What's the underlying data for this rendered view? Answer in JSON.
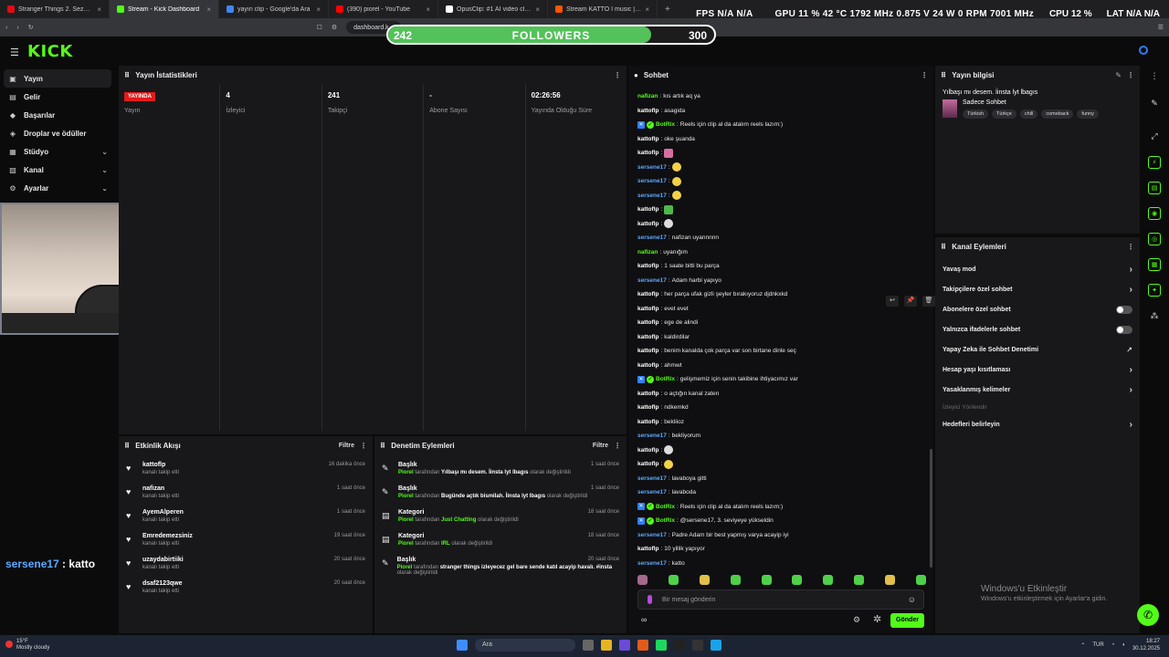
{
  "browser": {
    "tabs": [
      {
        "title": "Stranger Things 2. Sezon 5. Bölüm izle",
        "color": "#e50914",
        "active": false
      },
      {
        "title": "Stream - Kick Dashboard",
        "color": "#53fc18",
        "active": true
      },
      {
        "title": "yayın clip - Google'da Ara",
        "color": "#4285f4",
        "active": false
      },
      {
        "title": "(390) piorel - YouTube",
        "color": "#ff0000",
        "active": false
      },
      {
        "title": "OpusClip: #1 AI video clipping and e",
        "color": "#ffffff",
        "active": false
      },
      {
        "title": "Stream KATTO I music | Listen to sev",
        "color": "#ff5500",
        "active": false
      }
    ],
    "new_tab": "+",
    "address": "dashboard.k"
  },
  "osd": {
    "fps_label": "FPS",
    "fps_val1": "N/A",
    "fps_val2": "N/A",
    "gpu_label": "GPU",
    "gpu_load": "11 %",
    "gpu_temp": "42 °C",
    "gpu_clock": "1792 MHz",
    "gpu_volt": "0.875 V",
    "gpu_power": "24 W",
    "gpu_fan": "0 RPM",
    "gpu_mem": "7001 MHz",
    "cpu_label": "CPU",
    "cpu_load": "12 %",
    "lat_label": "LAT",
    "lat_val1": "N/A",
    "lat_val2": "N/A"
  },
  "followers": {
    "current": "242",
    "label": "FOLLOWERS",
    "goal": "300",
    "progress": 0.807
  },
  "header": {
    "logo": "KICK",
    "menu_icon": "hamburger-icon"
  },
  "nav": [
    {
      "label": "Yayın",
      "icon": "▣",
      "chev": "",
      "active": true
    },
    {
      "label": "Gelir",
      "icon": "▤",
      "chev": "",
      "active": false
    },
    {
      "label": "Başarılar",
      "icon": "◆",
      "chev": "",
      "active": false
    },
    {
      "label": "Droplar ve ödüller",
      "icon": "◈",
      "chev": "",
      "active": false
    },
    {
      "label": "Stüdyo",
      "icon": "▦",
      "chev": "⌄",
      "active": false
    },
    {
      "label": "Kanal",
      "icon": "▧",
      "chev": "⌄",
      "active": false
    },
    {
      "label": "Ayarlar",
      "icon": "⚙",
      "chev": "⌄",
      "active": false
    }
  ],
  "overlay_chat": {
    "user": "sersene17",
    "sep": " : ",
    "text": "katto"
  },
  "stats": {
    "title": "Yayın İstatistikleri",
    "cols": [
      {
        "value": "YAYINDA",
        "label": "Yayın",
        "live": true
      },
      {
        "value": "4",
        "label": "İzleyici",
        "live": false
      },
      {
        "value": "241",
        "label": "Takipçi",
        "live": false
      },
      {
        "value": "-",
        "label": "Abone Sayısı",
        "live": false
      },
      {
        "value": "02:26:56",
        "label": "Yayında Olduğu Süre",
        "live": false
      }
    ]
  },
  "activity": {
    "title": "Etkinlik Akışı",
    "filter": "Filtre",
    "items": [
      {
        "name": "kattoflp",
        "desc": "kanalı takip etti",
        "time": "16 dakika önce"
      },
      {
        "name": "nafizan",
        "desc": "kanalı takip etti",
        "time": "1 saat önce"
      },
      {
        "name": "AyemAlperen",
        "desc": "kanalı takip etti",
        "time": "1 saat önce"
      },
      {
        "name": "Emredemezsiniz",
        "desc": "kanalı takip etti",
        "time": "19 saat önce"
      },
      {
        "name": "uzaydabirtiiki",
        "desc": "kanalı takip etti",
        "time": "20 saat önce"
      },
      {
        "name": "dsaf2123qwe",
        "desc": "kanalı takip etti",
        "time": "20 saat önce"
      }
    ]
  },
  "moderation": {
    "title": "Denetim Eylemleri",
    "filter": "Filtre",
    "items": [
      {
        "type": "Başlık",
        "icon": "✎",
        "actor": "Piorel",
        "mid": " tarafından ",
        "value": "Yılbaşı mı desem. İinsta lyt lbagıs",
        "end": " olarak değiştirildi",
        "time": "1 saat önce",
        "green": false
      },
      {
        "type": "Başlık",
        "icon": "✎",
        "actor": "Piorel",
        "mid": " tarafından ",
        "value": "Bugünde açtık bismilah. İinsta lyt lbagıs",
        "end": " olarak değiştirildi",
        "time": "1 saat önce",
        "green": false
      },
      {
        "type": "Kategori",
        "icon": "▤",
        "actor": "Piorel",
        "mid": " tarafından ",
        "value": "Just Chatting",
        "end": " olarak değiştirildi",
        "time": "18 saat önce",
        "green": true
      },
      {
        "type": "Kategori",
        "icon": "▤",
        "actor": "Piorel",
        "mid": " tarafından ",
        "value": "IRL",
        "end": " olarak değiştirildi",
        "time": "18 saat önce",
        "green": true
      },
      {
        "type": "Başlık",
        "icon": "✎",
        "actor": "Piorel",
        "mid": " tarafından ",
        "value": "stranger things izleyecez gel bare sende katıl acayip havalı. #insta",
        "end": " olarak değiştirildi",
        "time": "20 saat önce",
        "green": false
      }
    ]
  },
  "chat": {
    "title": "Sohbet",
    "messages": [
      {
        "user": "nafizan",
        "color": "#53fc18",
        "text": "kıs artık aq ya",
        "badge": false,
        "emote": ""
      },
      {
        "user": "kattoflp",
        "color": "#ffffff",
        "text": "asagida",
        "badge": false,
        "emote": ""
      },
      {
        "user": "BotRix",
        "color": "#53fc18",
        "text": "Reels için clip al da atalım reels lazım:)",
        "badge": true,
        "emote": ""
      },
      {
        "user": "kattoflp",
        "color": "#ffffff",
        "text": "oke şuanda",
        "badge": false,
        "emote": ""
      },
      {
        "user": "kattoflp",
        "color": "#ffffff",
        "text": "",
        "badge": false,
        "emote": "pink"
      },
      {
        "user": "sersene17",
        "color": "#5aa9ff",
        "text": "",
        "badge": false,
        "emote": "y"
      },
      {
        "user": "sersene17",
        "color": "#5aa9ff",
        "text": "",
        "badge": false,
        "emote": "y"
      },
      {
        "user": "sersene17",
        "color": "#5aa9ff",
        "text": "",
        "badge": false,
        "emote": "y"
      },
      {
        "user": "kattoflp",
        "color": "#ffffff",
        "text": "",
        "badge": false,
        "emote": "grn"
      },
      {
        "user": "kattoflp",
        "color": "#ffffff",
        "text": "",
        "badge": false,
        "emote": "w"
      },
      {
        "user": "sersene17",
        "color": "#5aa9ff",
        "text": "nafizan uyannnnn",
        "badge": false,
        "emote": ""
      },
      {
        "user": "nafizan",
        "color": "#53fc18",
        "text": "uyanığım",
        "badge": false,
        "emote": ""
      },
      {
        "user": "kattoflp",
        "color": "#ffffff",
        "text": "1 saate bitti bu parça",
        "badge": false,
        "emote": ""
      },
      {
        "user": "sersene17",
        "color": "#5aa9ff",
        "text": "Adam harbi yapıyo",
        "badge": false,
        "emote": ""
      },
      {
        "user": "kattoflp",
        "color": "#ffffff",
        "text": "her parça ufak gizli şeyler bırakıyoruz djdnkxkd",
        "badge": false,
        "emote": ""
      },
      {
        "user": "kattoflp",
        "color": "#ffffff",
        "text": "evet evet",
        "badge": false,
        "emote": ""
      },
      {
        "user": "kattoflp",
        "color": "#ffffff",
        "text": "ege de alindi",
        "badge": false,
        "emote": ""
      },
      {
        "user": "kattoflp",
        "color": "#ffffff",
        "text": "kaldirdilar",
        "badge": false,
        "emote": ""
      },
      {
        "user": "kattoflp",
        "color": "#ffffff",
        "text": "benim kanalda çok parça var son birtane dinle seç",
        "badge": false,
        "emote": ""
      },
      {
        "user": "kattoflp",
        "color": "#ffffff",
        "text": "ahmwt",
        "badge": false,
        "emote": ""
      },
      {
        "user": "BotRix",
        "color": "#53fc18",
        "text": "gelişmemiz için senin takibine ihtiyacımız var",
        "badge": true,
        "emote": ""
      },
      {
        "user": "kattoflp",
        "color": "#ffffff",
        "text": "o açtığın kanal zaten",
        "badge": false,
        "emote": ""
      },
      {
        "user": "kattoflp",
        "color": "#ffffff",
        "text": "ndkemkd",
        "badge": false,
        "emote": ""
      },
      {
        "user": "kattoflp",
        "color": "#ffffff",
        "text": "bekliioz",
        "badge": false,
        "emote": ""
      },
      {
        "user": "sersene17",
        "color": "#5aa9ff",
        "text": "bekliyorum",
        "badge": false,
        "emote": ""
      },
      {
        "user": "kattoflp",
        "color": "#ffffff",
        "text": "",
        "badge": false,
        "emote": "w"
      },
      {
        "user": "kattoflp",
        "color": "#ffffff",
        "text": "",
        "badge": false,
        "emote": "y"
      },
      {
        "user": "sersene17",
        "color": "#5aa9ff",
        "text": "lavaboya gitti",
        "badge": false,
        "emote": ""
      },
      {
        "user": "sersene17",
        "color": "#5aa9ff",
        "text": "lavaboda",
        "badge": false,
        "emote": ""
      },
      {
        "user": "BotRix",
        "color": "#53fc18",
        "text": "Reels için clip al da atalım reels lazım:)",
        "badge": true,
        "emote": ""
      },
      {
        "user": "BotRix",
        "color": "#53fc18",
        "text": "@sersene17, 3. seviyeye yükseldin",
        "badge": true,
        "emote": ""
      },
      {
        "user": "sersene17",
        "color": "#5aa9ff",
        "text": "Padre Adam bir best yapmış varya acayip iyi",
        "badge": false,
        "emote": ""
      },
      {
        "user": "kattoflp",
        "color": "#ffffff",
        "text": "10 yillik yapıyor",
        "badge": false,
        "emote": ""
      },
      {
        "user": "sersene17",
        "color": "#5aa9ff",
        "text": "katto",
        "badge": false,
        "emote": ""
      }
    ],
    "input_placeholder": "Bir mesaj gönderin",
    "send": "Gönder",
    "infinity": "∞"
  },
  "stream_info": {
    "title": "Yayın bilgisi",
    "stream_title": "Yılbaşı mı desem. İinsta lyt lbagıs",
    "category": "Sadece Sohbet",
    "tags": [
      "Türkish",
      "Türkçe",
      "chill",
      "comeback",
      "funny"
    ]
  },
  "channel_actions": {
    "title": "Kanal Eylemleri",
    "items": [
      {
        "label": "Yavaş mod",
        "ctrl": "arrow"
      },
      {
        "label": "Takipçilere özel sohbet",
        "ctrl": "arrow"
      },
      {
        "label": "Abonelere özel sohbet",
        "ctrl": "toggle"
      },
      {
        "label": "Yalnızca ifadelerle sohbet",
        "ctrl": "toggle"
      },
      {
        "label": "Yapay Zeka ile Sohbet Denetimi",
        "ctrl": "ext"
      },
      {
        "label": "Hesap yaşı kısıtlaması",
        "ctrl": "arrow"
      },
      {
        "label": "Yasaklanmış kelimeler",
        "ctrl": "arrow"
      }
    ],
    "section": "İzleyici Yönlendir",
    "goals": "Hedefleri belirleyin"
  },
  "watermark": {
    "title": "Windows'u Etkinleştir",
    "sub": "Windows'u etkinleştirmek için Ayarlar'a gidin."
  },
  "taskbar": {
    "temp": "15°F",
    "weather": "Mostly cloudy",
    "search": "Ara",
    "lang": "TUR",
    "time": "18:27",
    "date": "30.12.2025"
  }
}
